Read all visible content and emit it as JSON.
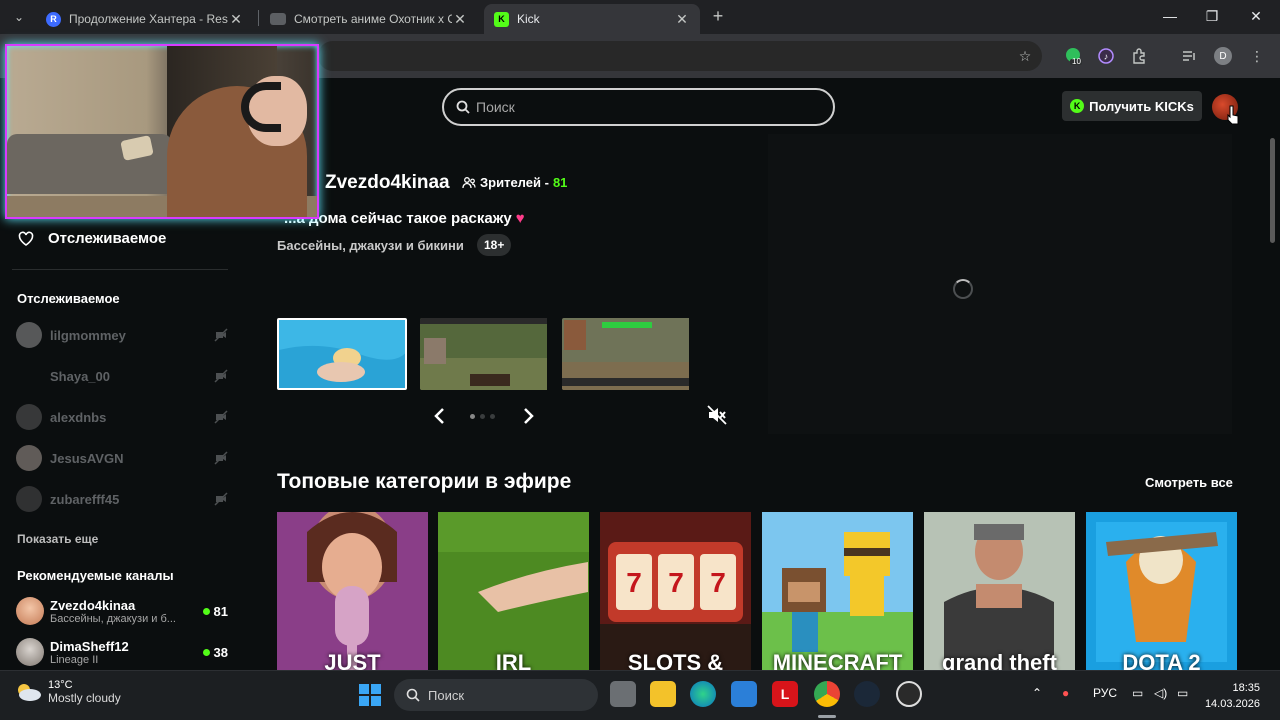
{
  "browser": {
    "tabs": [
      {
        "label": "Продолжение Хантера - Restr",
        "favicon": "R",
        "active": false
      },
      {
        "label": "Смотреть аниме Охотник х Ох",
        "favicon": "",
        "active": false
      },
      {
        "label": "Kick",
        "favicon": "K",
        "active": true
      }
    ],
    "profile_initial": "D",
    "extension_badge": "10"
  },
  "header": {
    "search_placeholder": "Поиск",
    "kicks_button": "Получить KICKs"
  },
  "sidebar": {
    "following_top": "Отслеживаемое",
    "following_heading": "Отслеживаемое",
    "following": [
      {
        "name": "lilgmommey"
      },
      {
        "name": "Shaya_00"
      },
      {
        "name": "alexdnbs"
      },
      {
        "name": "JesusAVGN"
      },
      {
        "name": "zubarefff45"
      }
    ],
    "show_more": "Показать еще",
    "recommended_heading": "Рекомендуемые каналы",
    "recommended": [
      {
        "name": "Zvezdo4kinaa",
        "sub": "Бассейны, джакузи и б...",
        "viewers": "81"
      },
      {
        "name": "DimaSheff12",
        "sub": "Lineage II",
        "viewers": "38"
      }
    ]
  },
  "featured": {
    "streamer": "Zvezdo4kinaa",
    "viewers_label": "Зрителей -",
    "viewers": "81",
    "title": "...а дома сейчас такое раскажу",
    "category": "Бассейны, джакузи и бикини",
    "badge": "18+"
  },
  "categories": {
    "title": "Топовые категории в эфире",
    "see_all": "Смотреть все",
    "cards": [
      {
        "overlay": "JUST"
      },
      {
        "overlay": "IRL"
      },
      {
        "overlay": "SLOTS &"
      },
      {
        "overlay": "MINECRAFT"
      },
      {
        "overlay": "grand theft"
      },
      {
        "overlay": "DOTA 2"
      }
    ]
  },
  "taskbar": {
    "weather_temp": "13°C",
    "weather_desc": "Mostly cloudy",
    "search": "Поиск",
    "lang": "РУС",
    "time": "18:35",
    "date": "14.03.2026"
  },
  "colors": {
    "kick_green": "#53fc18",
    "page_bg": "#0b0e0f"
  }
}
